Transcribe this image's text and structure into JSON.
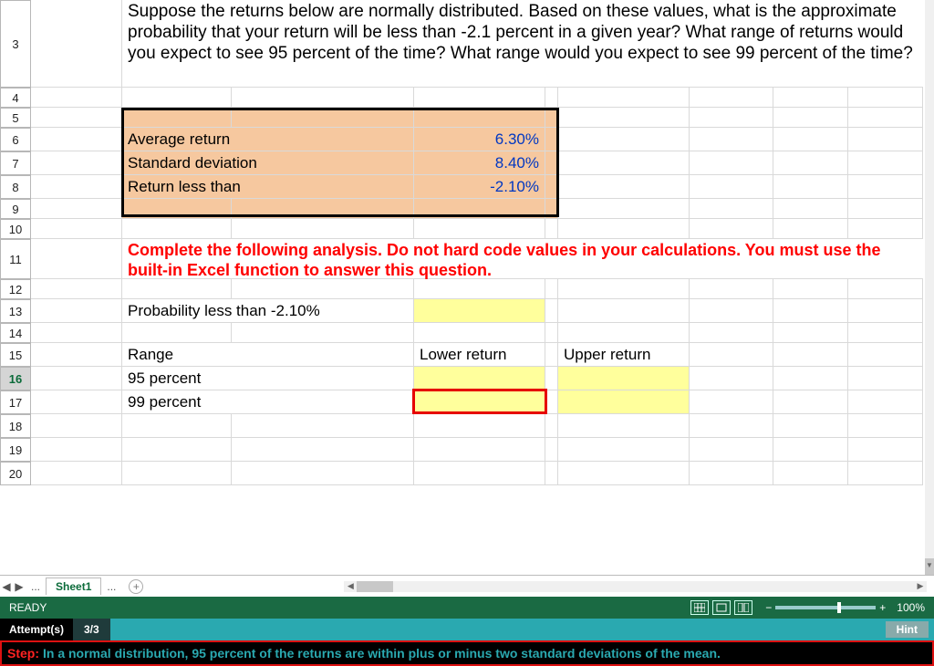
{
  "rows": {
    "r3": "3",
    "r4": "4",
    "r5": "5",
    "r6": "6",
    "r7": "7",
    "r8": "8",
    "r9": "9",
    "r10": "10",
    "r11": "11",
    "r12": "12",
    "r13": "13",
    "r14": "14",
    "r15": "15",
    "r16": "16",
    "r17": "17",
    "r18": "18",
    "r19": "19",
    "r20": "20"
  },
  "question": "Suppose the returns below are normally distributed. Based on these values, what is the approximate probability that your return will be less than -2.1 percent in a given year? What range of returns would you expect to see 95 percent of the time? What range would you expect to see 99 percent of the time?",
  "inputs": {
    "avg_label": "Average return",
    "avg_value": "6.30%",
    "std_label": "Standard deviation",
    "std_value": "8.40%",
    "lt_label": "Return less than",
    "lt_value": "-2.10%"
  },
  "instruction": "Complete the following analysis. Do not hard code values in your calculations. You must use the built-in Excel function to answer this question.",
  "analysis": {
    "prob_label": "Probability less than -2.10%",
    "range_label": "Range",
    "lower_label": "Lower return",
    "upper_label": "Upper return",
    "p95": "95 percent",
    "p99": "99 percent"
  },
  "tabs": {
    "sheet": "Sheet1",
    "dots": "...",
    "plus": "+"
  },
  "status": {
    "ready": "READY",
    "zoom": "100%"
  },
  "attempts": {
    "label": "Attempt(s)",
    "count": "3/3",
    "hint": "Hint"
  },
  "step": {
    "prefix": "Step:",
    "text": "In a normal distribution, 95 percent of the returns are within plus or minus two standard deviations of the mean."
  }
}
